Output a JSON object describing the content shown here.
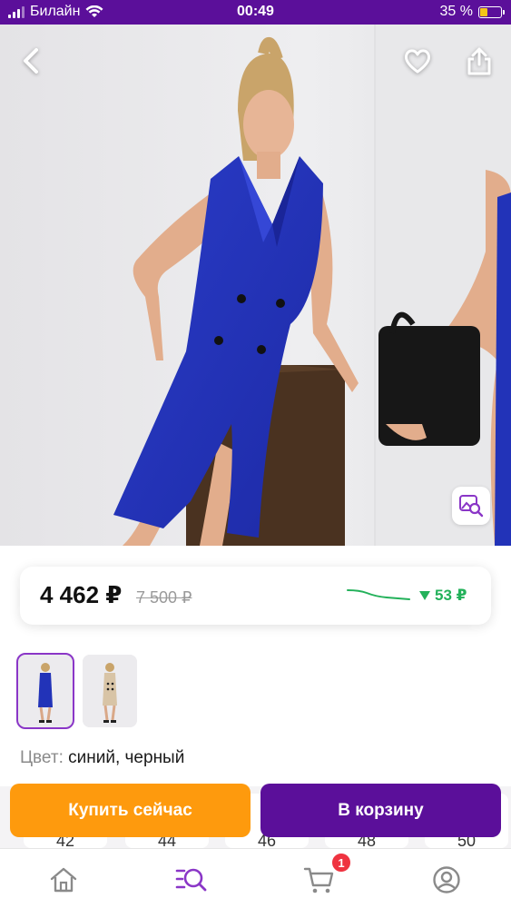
{
  "status_bar": {
    "carrier": "Билайн",
    "time": "00:49",
    "battery_percent": "35 %",
    "battery_level": 0.35
  },
  "gallery": {
    "back_icon": "chevron-left-icon",
    "favorite_icon": "heart-icon",
    "share_icon": "share-icon",
    "image_search_icon": "image-search-icon"
  },
  "price": {
    "current": "4 462 ₽",
    "old": "7 500 ₽",
    "drop": "53 ₽",
    "drop_color": "#23b15a"
  },
  "thumbnails": [
    {
      "color": "blue",
      "selected": true
    },
    {
      "color": "beige",
      "selected": false
    }
  ],
  "color": {
    "label": "Цвет:",
    "value": "синий, черный"
  },
  "sizes": [
    "42",
    "44",
    "46",
    "48",
    "50"
  ],
  "actions": {
    "buy_now": "Купить сейчас",
    "add_to_cart": "В корзину",
    "buy_color": "#fe9a0d",
    "cart_color": "#5b0f9a"
  },
  "tabbar": {
    "items": [
      "home-icon",
      "catalog-search-icon",
      "cart-icon",
      "profile-icon"
    ],
    "cart_badge": "1",
    "accent": "#8a36c7"
  }
}
